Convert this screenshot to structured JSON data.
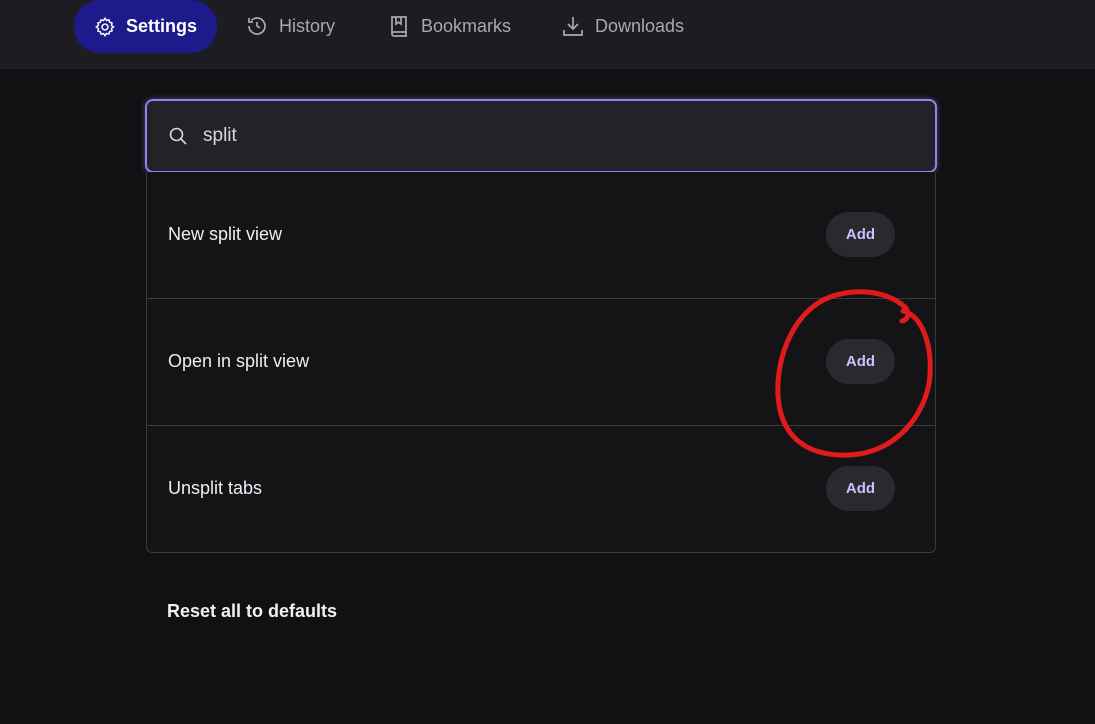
{
  "nav": {
    "tabs": [
      {
        "label": "Settings",
        "icon": "gear-icon",
        "active": true
      },
      {
        "label": "History",
        "icon": "history-icon",
        "active": false
      },
      {
        "label": "Bookmarks",
        "icon": "bookmark-icon",
        "active": false
      },
      {
        "label": "Downloads",
        "icon": "download-icon",
        "active": false
      }
    ]
  },
  "search": {
    "value": "split",
    "icon": "search-icon"
  },
  "results": [
    {
      "label": "New split view",
      "button": "Add"
    },
    {
      "label": "Open in split view",
      "button": "Add"
    },
    {
      "label": "Unsplit tabs",
      "button": "Add"
    }
  ],
  "footer": {
    "reset_label": "Reset all to defaults"
  },
  "colors": {
    "accent": "#1d1a8c",
    "annotation": "#e01b1b",
    "focus_border": "#8c87e8"
  }
}
